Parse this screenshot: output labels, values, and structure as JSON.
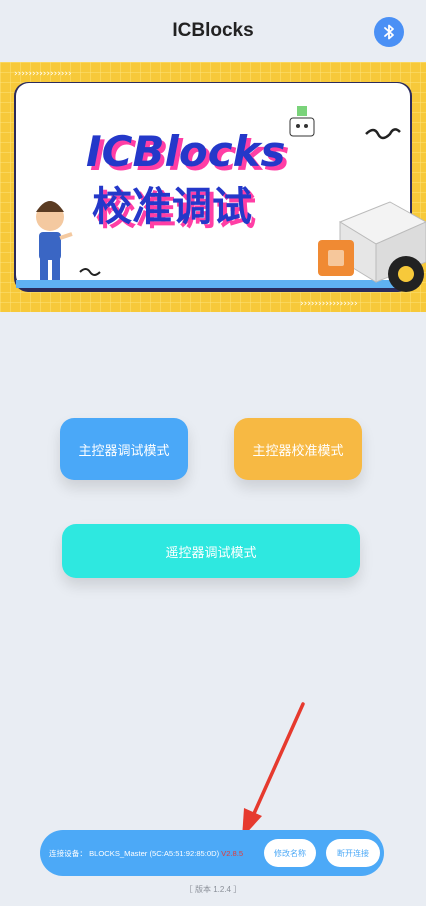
{
  "header": {
    "title": "ICBlocks",
    "bluetooth_icon": "bluetooth-icon"
  },
  "banner": {
    "title_line1": "ICBlocks",
    "title_line2": "校准调试",
    "colors": {
      "border": "#f7c93a",
      "title_blue": "#2438c9",
      "title_pink": "#ff3ea5"
    }
  },
  "buttons": {
    "main_debug": "主控器调试模式",
    "main_calibrate": "主控器校准模式",
    "remote_debug": "遥控器调试模式"
  },
  "status": {
    "device_prefix": "连接设备：",
    "device_name": "BLOCKS_Master",
    "device_mac": "(5C:A5:51:92:85:0D)",
    "firmware_version": "V2.8.5",
    "rename_label": "修改名称",
    "disconnect_label": "断开连接"
  },
  "app_version": "［ 版本 1.2.4 ］",
  "colors": {
    "accent_blue": "#4ca9f7",
    "accent_orange": "#f7b943",
    "accent_cyan": "#2ee8e0",
    "version_red": "#e23b3b",
    "arrow_red": "#e63a2e"
  }
}
